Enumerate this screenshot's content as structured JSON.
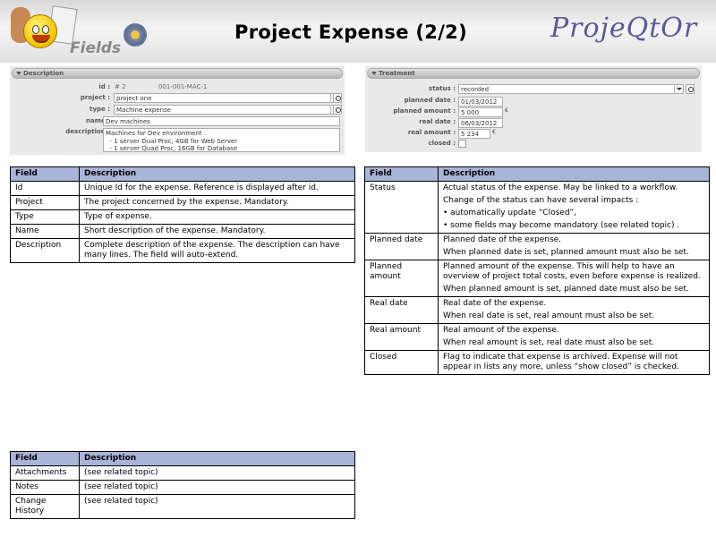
{
  "header": {
    "title": "Project Expense (2/2)",
    "brand": "ProjeQtOr",
    "logo_word": "Fields"
  },
  "description_panel": {
    "section_title": "Description",
    "id_label": "id :",
    "id_value": "# 2",
    "id_reference": "001-001-MAC-1",
    "project_label": "project :",
    "project_value": "project one",
    "type_label": "type :",
    "type_value": "Machine expense",
    "name_label": "name :",
    "name_value": "Dev machines",
    "description_label": "description :",
    "description_value": "Machines for Dev environment :\n  - 1 server Dual Proc, 4GB for Web Server\n  - 1 server Quad Proc, 16GB for Database"
  },
  "treatment_panel": {
    "section_title": "Treatment",
    "status_label": "status :",
    "status_value": "recorded",
    "planned_date_label": "planned date :",
    "planned_date_value": "01/03/2012",
    "planned_amount_label": "planned amount :",
    "planned_amount_value": "5 000",
    "real_date_label": "real date :",
    "real_date_value": "06/03/2012",
    "real_amount_label": "real amount :",
    "real_amount_value": "5 234",
    "currency": "€",
    "closed_label": "closed :"
  },
  "table_headers": {
    "field": "Field",
    "description": "Description"
  },
  "table_left": [
    {
      "field": "Id",
      "desc": [
        "Unique Id for the expense. Reference is displayed after id."
      ]
    },
    {
      "field": "Project",
      "desc": [
        "The project concerned by the expense. Mandatory."
      ]
    },
    {
      "field": "Type",
      "desc": [
        "Type of expense."
      ]
    },
    {
      "field": "Name",
      "desc": [
        "Short description of the expense. Mandatory."
      ]
    },
    {
      "field": "Description",
      "desc": [
        "Complete description of the expense. The description can have many lines. The field will auto-extend."
      ]
    }
  ],
  "table_right": [
    {
      "field": "Status",
      "desc": [
        "Actual status of the expense. May be linked to a workflow.",
        "Change of the status can have several impacts :",
        "• automatically update “Closed”,",
        "• some fields may become mandatory (see related topic) ."
      ]
    },
    {
      "field": "Planned date",
      "desc": [
        "Planned date of the expense.",
        "When planned date is set, planned amount must also be set."
      ]
    },
    {
      "field": "Planned amount",
      "desc": [
        "Planned amount of the expense. This will help to have an overview of  project total costs, even before expense is realized.",
        "When planned amount is set, planned date must also be set."
      ]
    },
    {
      "field": "Real date",
      "desc": [
        "Real date of the expense.",
        "When real date is set, real amount must also be set."
      ]
    },
    {
      "field": "Real amount",
      "desc": [
        "Real amount of the expense.",
        "When real amount is set, real date must also be set."
      ]
    },
    {
      "field": "Closed",
      "desc": [
        "Flag to indicate that expense is archived. Expense will not appear in lists any more, unless “show closed” is checked."
      ]
    }
  ],
  "table_bottom": [
    {
      "field": "Attachments",
      "desc": [
        "(see related topic)"
      ]
    },
    {
      "field": "Notes",
      "desc": [
        "(see related topic)"
      ]
    },
    {
      "field": "Change History",
      "desc": [
        "(see related topic)"
      ]
    }
  ]
}
